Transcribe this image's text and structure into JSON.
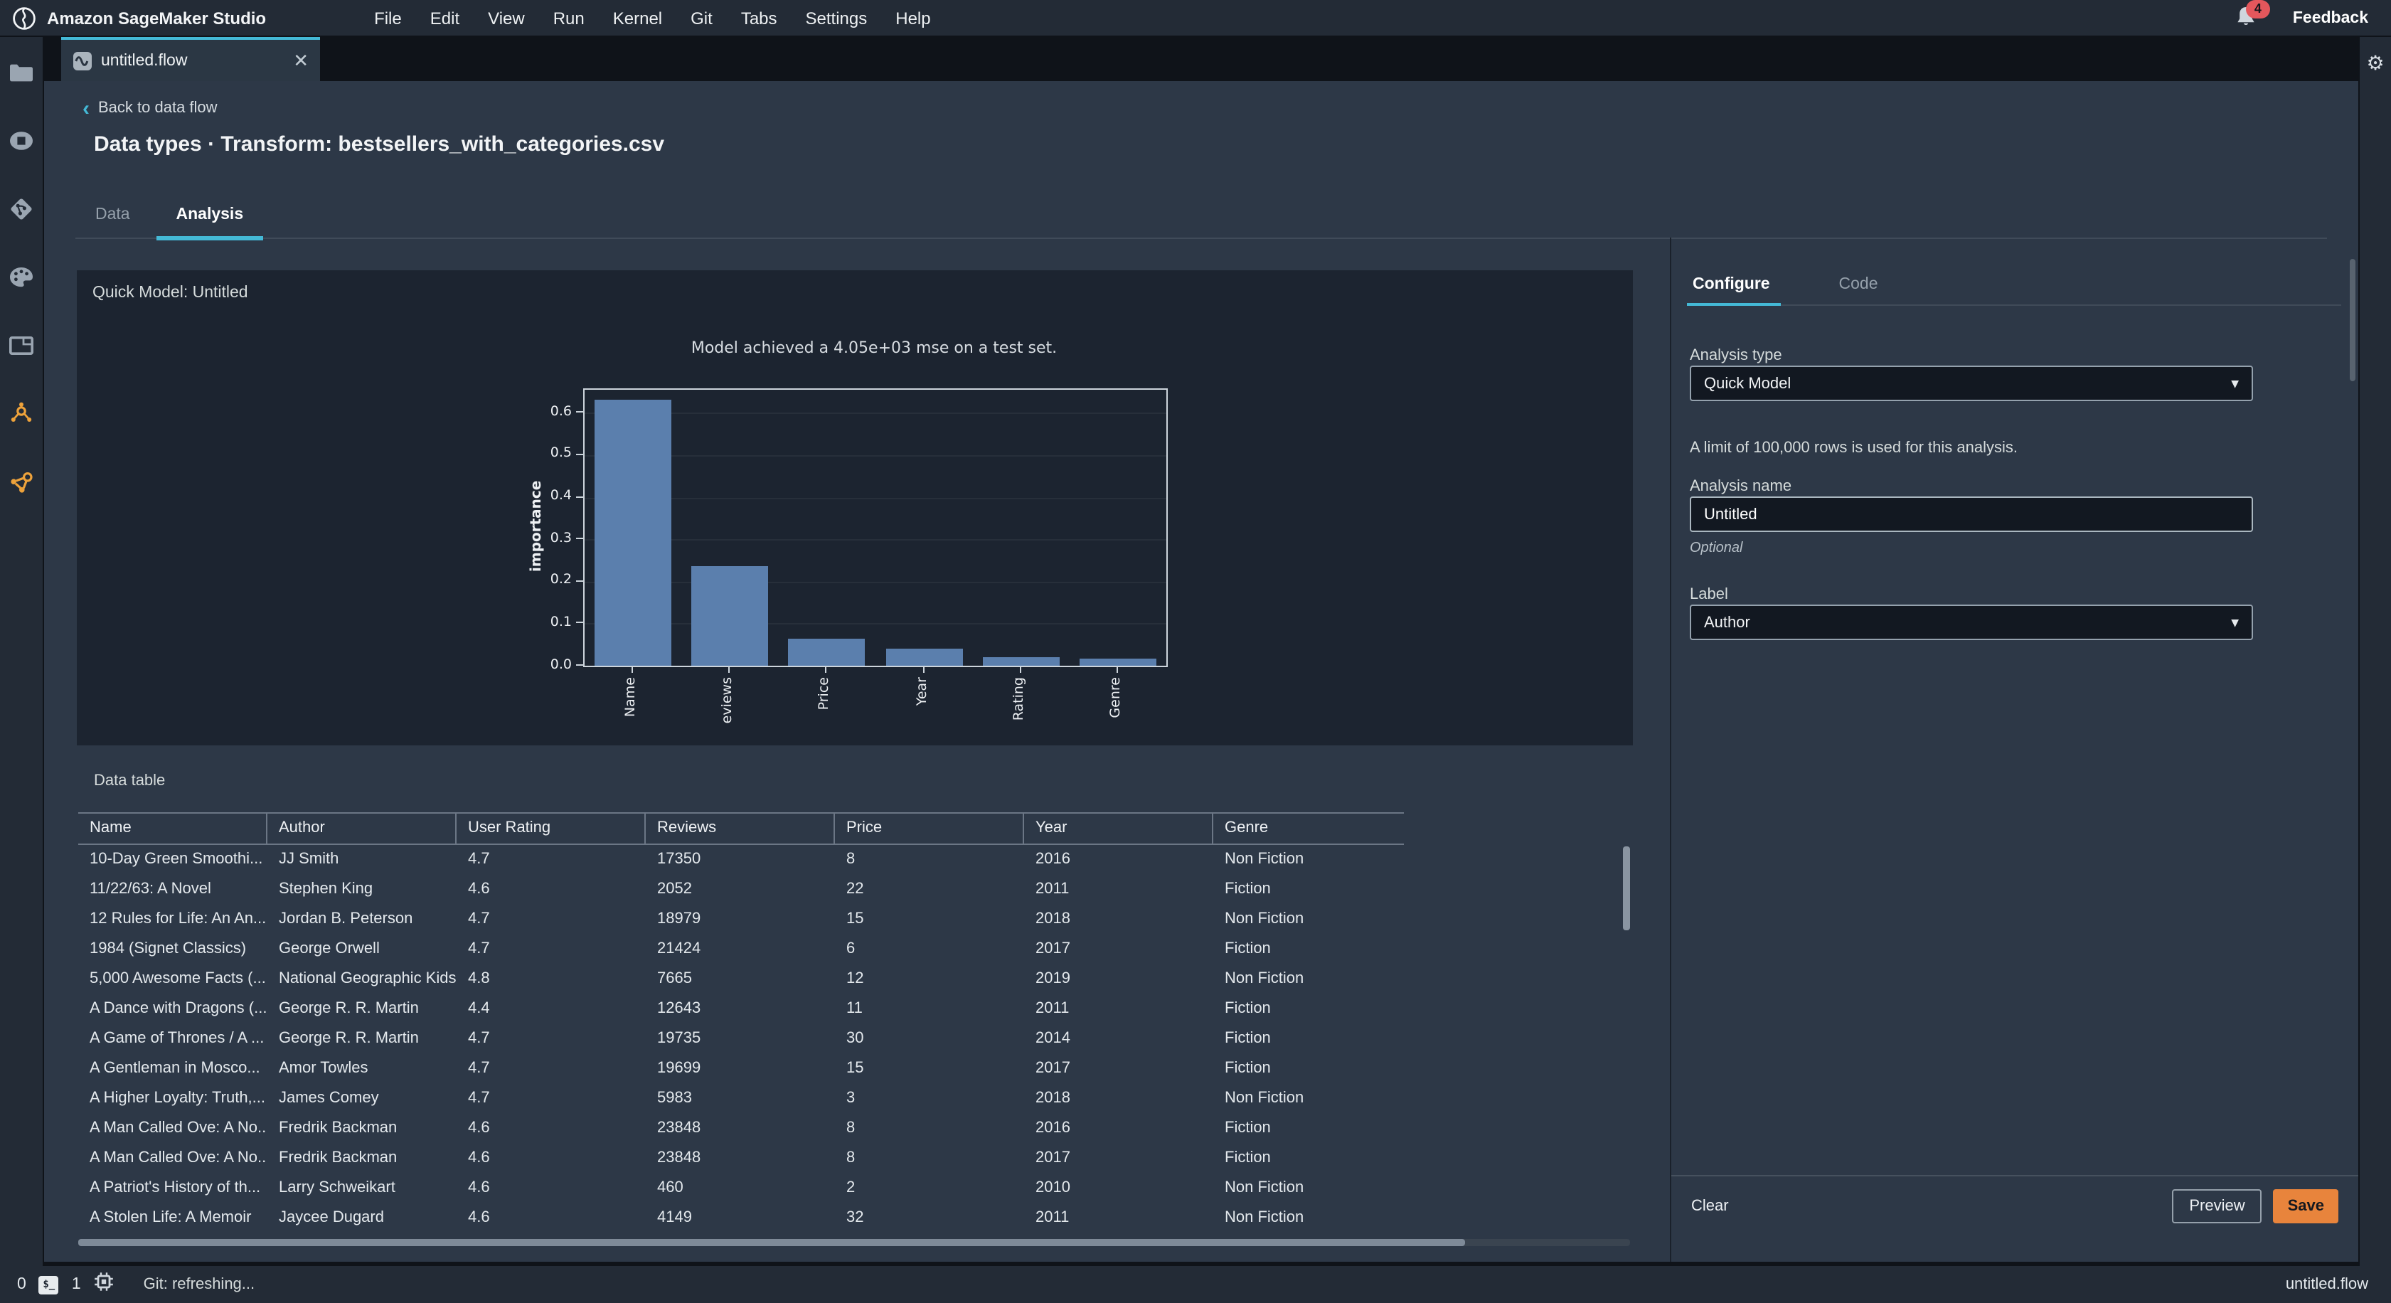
{
  "topbar": {
    "app_title": "Amazon SageMaker Studio",
    "menus": [
      "File",
      "Edit",
      "View",
      "Run",
      "Kernel",
      "Git",
      "Tabs",
      "Settings",
      "Help"
    ],
    "notification_count": "4",
    "feedback_label": "Feedback"
  },
  "doc_tab": {
    "label": "untitled.flow"
  },
  "header": {
    "back_label": "Back to data flow",
    "title": "Data types · Transform: bestsellers_with_categories.csv",
    "tab_data": "Data",
    "tab_analysis": "Analysis"
  },
  "quick_model": {
    "panel_title": "Quick Model: Untitled"
  },
  "chart_data": {
    "type": "bar",
    "title": "Model achieved a 4.05e+03 mse on a test set.",
    "categories": [
      "Name",
      "eviews",
      "Price",
      "Year",
      "Rating",
      "Genre"
    ],
    "values": [
      0.63,
      0.235,
      0.065,
      0.04,
      0.02,
      0.017
    ],
    "xlabel": "",
    "ylabel": "importance",
    "yticks": [
      0.0,
      0.1,
      0.2,
      0.3,
      0.4,
      0.5,
      0.6
    ],
    "ylim": [
      0,
      0.655
    ],
    "bar_color": "#5b7fad",
    "grid": true,
    "legend": false
  },
  "data_table": {
    "label": "Data table",
    "columns": [
      "Name",
      "Author",
      "User Rating",
      "Reviews",
      "Price",
      "Year",
      "Genre"
    ],
    "rows": [
      [
        "10-Day Green Smoothi...",
        "JJ Smith",
        "4.7",
        "17350",
        "8",
        "2016",
        "Non Fiction"
      ],
      [
        "11/22/63: A Novel",
        "Stephen King",
        "4.6",
        "2052",
        "22",
        "2011",
        "Fiction"
      ],
      [
        "12 Rules for Life: An An...",
        "Jordan B. Peterson",
        "4.7",
        "18979",
        "15",
        "2018",
        "Non Fiction"
      ],
      [
        "1984 (Signet Classics)",
        "George Orwell",
        "4.7",
        "21424",
        "6",
        "2017",
        "Fiction"
      ],
      [
        "5,000 Awesome Facts (...",
        "National Geographic Kids",
        "4.8",
        "7665",
        "12",
        "2019",
        "Non Fiction"
      ],
      [
        "A Dance with Dragons (...",
        "George R. R. Martin",
        "4.4",
        "12643",
        "11",
        "2011",
        "Fiction"
      ],
      [
        "A Game of Thrones / A ...",
        "George R. R. Martin",
        "4.7",
        "19735",
        "30",
        "2014",
        "Fiction"
      ],
      [
        "A Gentleman in Mosco...",
        "Amor Towles",
        "4.7",
        "19699",
        "15",
        "2017",
        "Fiction"
      ],
      [
        "A Higher Loyalty: Truth,...",
        "James Comey",
        "4.7",
        "5983",
        "3",
        "2018",
        "Non Fiction"
      ],
      [
        "A Man Called Ove: A No...",
        "Fredrik Backman",
        "4.6",
        "23848",
        "8",
        "2016",
        "Fiction"
      ],
      [
        "A Man Called Ove: A No...",
        "Fredrik Backman",
        "4.6",
        "23848",
        "8",
        "2017",
        "Fiction"
      ],
      [
        "A Patriot's History of th...",
        "Larry Schweikart",
        "4.6",
        "460",
        "2",
        "2010",
        "Non Fiction"
      ],
      [
        "A Stolen Life: A Memoir",
        "Jaycee Dugard",
        "4.6",
        "4149",
        "32",
        "2011",
        "Non Fiction"
      ]
    ]
  },
  "config_panel": {
    "tab_configure": "Configure",
    "tab_code": "Code",
    "analysis_type_label": "Analysis type",
    "analysis_type_value": "Quick Model",
    "row_limit_note": "A limit of 100,000 rows is used for this analysis.",
    "analysis_name_label": "Analysis name",
    "analysis_name_value": "Untitled",
    "optional_note": "Optional",
    "label_label": "Label",
    "label_value": "Author",
    "footer": {
      "clear": "Clear",
      "preview": "Preview",
      "save": "Save"
    }
  },
  "status_bar": {
    "terminal_count": "0",
    "kernel_count": "1",
    "git_status": "Git: refreshing...",
    "active_file": "untitled.flow"
  },
  "colors": {
    "accent_blue": "#44b9d6",
    "save_orange": "#e8843c",
    "bar_blue": "#5b7fad",
    "badge_red": "#e4575c"
  }
}
